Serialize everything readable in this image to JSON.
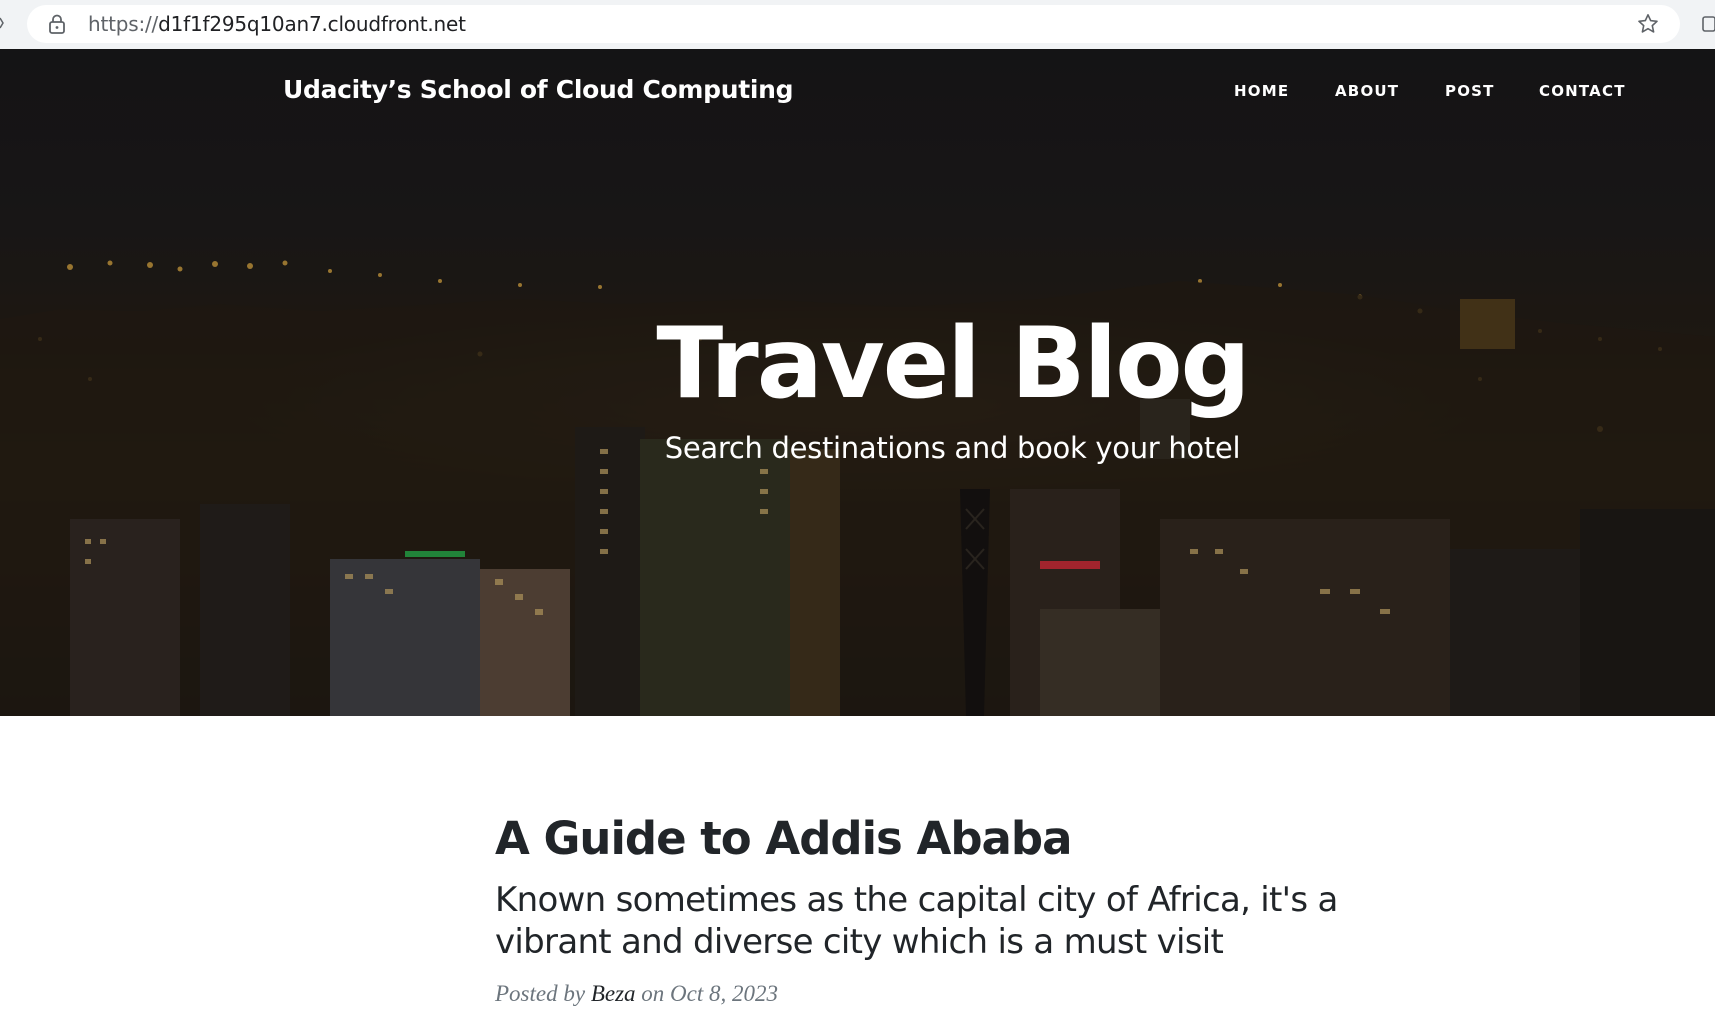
{
  "browser": {
    "url_protocol": "https://",
    "url_host": "d1f1f295q10an7.cloudfront.net"
  },
  "site": {
    "brand": "Udacity’s School of Cloud Computing",
    "nav": [
      {
        "label": "HOME"
      },
      {
        "label": "ABOUT"
      },
      {
        "label": "POST"
      },
      {
        "label": "CONTACT"
      }
    ]
  },
  "hero": {
    "title": "Travel Blog",
    "subtitle": "Search destinations and book your hotel"
  },
  "post": {
    "title": "A Guide to Addis Ababa",
    "subtitle": "Known sometimes as the capital city of Africa, it's a vibrant and diverse city which is a must visit",
    "meta_prefix": "Posted by",
    "author": "Beza",
    "meta_on": "on",
    "date": "Oct 8, 2023"
  }
}
